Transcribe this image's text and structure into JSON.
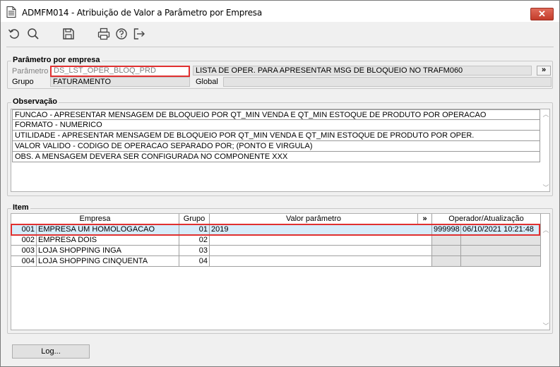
{
  "window": {
    "title": "ADMFM014 - Atribuição de Valor a Parâmetro por Empresa",
    "close_label": "✕"
  },
  "toolbar": {
    "icons": [
      "refresh-icon",
      "search-icon",
      "save-icon",
      "print-icon",
      "help-icon",
      "exit-icon"
    ]
  },
  "parametro_section": {
    "title": "Parâmetro por empresa",
    "parametro_label": "Parâmetro",
    "parametro_value": "DS_LST_OPER_BLOQ_PRD",
    "descricao_value": "LISTA DE OPER. PARA APRESENTAR MSG DE BLOQUEIO NO TRAFM060",
    "more_label": "»",
    "grupo_label": "Grupo",
    "grupo_value": "FATURAMENTO",
    "global_label": "Global",
    "global_value": ""
  },
  "observacao": {
    "title": "Observação",
    "lines": [
      "FUNCAO - APRESENTAR MENSAGEM DE BLOQUEIO POR QT_MIN VENDA E QT_MIN ESTOQUE DE PRODUTO POR OPERACAO",
      "FORMATO - NUMERICO",
      "UTILIDADE - APRESENTAR MENSAGEM DE BLOQUEIO POR QT_MIN VENDA E QT_MIN ESTOQUE DE PRODUTO POR OPER.",
      "VALOR VALIDO - CODIGO DE OPERACAO SEPARADO POR; (PONTO E VIRGULA)",
      "OBS. A MENSAGEM DEVERA SER CONFIGURADA NO COMPONENTE XXX"
    ]
  },
  "item": {
    "title": "Item",
    "headers": {
      "empresa": "Empresa",
      "grupo": "Grupo",
      "valor": "Valor parâmetro",
      "more": "»",
      "operador": "Operador/Atualização"
    },
    "rows": [
      {
        "code": "001",
        "empresa": "EMPRESA UM HOMOLOGACAO",
        "grupo": "01",
        "valor": "2019",
        "operador": "999998",
        "atualizacao": "06/10/2021 10:21:48"
      },
      {
        "code": "002",
        "empresa": "EMPRESA DOIS",
        "grupo": "02",
        "valor": "",
        "operador": "",
        "atualizacao": ""
      },
      {
        "code": "003",
        "empresa": "LOJA SHOPPING INGA",
        "grupo": "03",
        "valor": "",
        "operador": "",
        "atualizacao": ""
      },
      {
        "code": "004",
        "empresa": "LOJA SHOPPING CINQUENTA",
        "grupo": "04",
        "valor": "",
        "operador": "",
        "atualizacao": ""
      }
    ]
  },
  "footer": {
    "log_label": "Log..."
  }
}
